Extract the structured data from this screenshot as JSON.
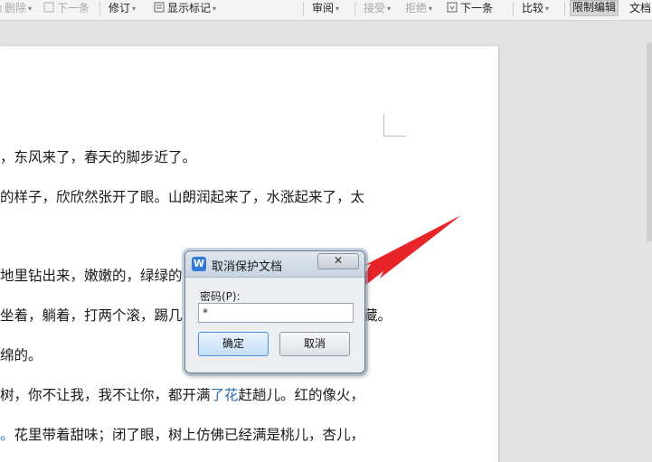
{
  "toolbar": {
    "items": [
      {
        "label": "删除",
        "disabled": true
      },
      {
        "label": "下一条",
        "disabled": true
      },
      {
        "label": "修订"
      },
      {
        "label": "显示标记"
      },
      {
        "label": "审阅"
      },
      {
        "label": "接受",
        "disabled": true
      },
      {
        "label": "拒绝",
        "disabled": true
      },
      {
        "label": "下一条"
      },
      {
        "label": "比较"
      },
      {
        "label": "限制编辑",
        "pressed": true
      },
      {
        "label": "文档"
      }
    ]
  },
  "document": {
    "lines": [
      {
        "text": "，东风来了，春天的脚步近了。"
      },
      {
        "text": "的样子，欣欣然张开了眼。山朗润起来了，水涨起来了，太"
      },
      {
        "text": "地里钻出来，嫩嫩的，绿绿的"
      },
      {
        "text": "坐着，躺着，打两个滚，踢几",
        "tail": "藏。"
      },
      {
        "text": "绵的。"
      },
      {
        "pre": "树，你不让我，我不让你，都开满",
        "link": "了花",
        "post": "赶趟儿。红的像火，"
      },
      {
        "pre": "。",
        "post": "花里带着甜味；闭了眼，树上仿佛已经满是桃儿，杏儿，"
      }
    ]
  },
  "dialog": {
    "title": "取消保护文档",
    "logo": "W",
    "close": "✕",
    "password_label": "密码(P):",
    "password_value": "*",
    "ok_label": "确定",
    "cancel_label": "取消"
  },
  "colors": {
    "link": "#2b6cb0",
    "arrow": "#e8242b",
    "accent": "#2f7bd6"
  }
}
